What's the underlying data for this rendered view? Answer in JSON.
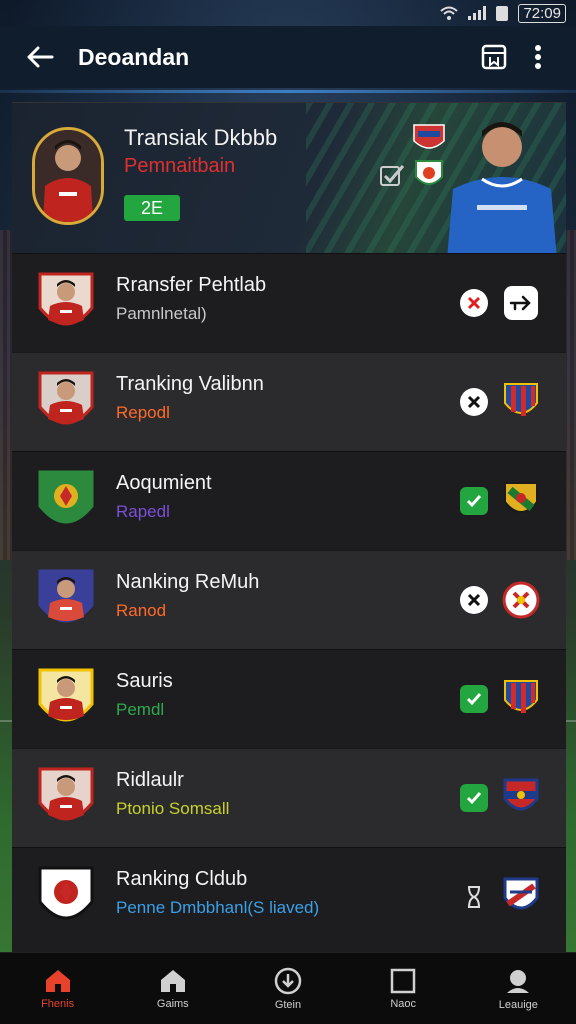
{
  "status_bar": {
    "time": "72:09"
  },
  "app_bar": {
    "title": "Deoandan"
  },
  "hero": {
    "name": "Transiak Dkbbb",
    "subtitle": "Pemnaitbain",
    "badge": "2E",
    "colors": {
      "subtitle": "#e03030",
      "badge": "#23a63f"
    }
  },
  "rows": [
    {
      "name": "Rransfer Pehtlab",
      "subtitle": "Pamnlnetal)",
      "sub_color": "#c9c9c9",
      "status": "cross-red",
      "trailing": "arrow-button"
    },
    {
      "name": "Tranking Valibnn",
      "subtitle": "Repodl",
      "sub_color": "#ff6a2a",
      "status": "cross-dark",
      "trailing": "crest-stripes"
    },
    {
      "name": "Aoqumient",
      "subtitle": "Rapedl",
      "sub_color": "#7b4fd6",
      "status": "check-green",
      "trailing": "crest-green"
    },
    {
      "name": "Nanking ReMuh",
      "subtitle": "Ranod",
      "sub_color": "#ff6a2a",
      "status": "cross-dark",
      "trailing": "crest-red-round"
    },
    {
      "name": "Sauris",
      "subtitle": "Pemdl",
      "sub_color": "#2fa84f",
      "status": "check-green",
      "trailing": "crest-stripes"
    },
    {
      "name": "Ridlaulr",
      "subtitle": "Ptonio Somsall",
      "sub_color": "#c7d12a",
      "status": "check-green",
      "trailing": "crest-blue-red"
    },
    {
      "name": "Ranking Cldub",
      "subtitle": "Penne Dmbbhanl(S liaved)",
      "sub_color": "#3aa0e8",
      "status": "hourglass",
      "trailing": "crest-shield"
    }
  ],
  "bottom_nav": [
    {
      "label": "Fhenis",
      "icon": "home-icon",
      "active": true
    },
    {
      "label": "Gaims",
      "icon": "home-outline-icon",
      "active": false
    },
    {
      "label": "Gtein",
      "icon": "download-circle-icon",
      "active": false
    },
    {
      "label": "Naoc",
      "icon": "square-icon",
      "active": false
    },
    {
      "label": "Leauige",
      "icon": "profile-icon",
      "active": false
    }
  ],
  "colors": {
    "accent": "#e8412c",
    "app_bar": "#0f1d2c",
    "list_bg": "#1d1d1f",
    "list_alt": "#2b2b2d",
    "check": "#23a63f"
  }
}
